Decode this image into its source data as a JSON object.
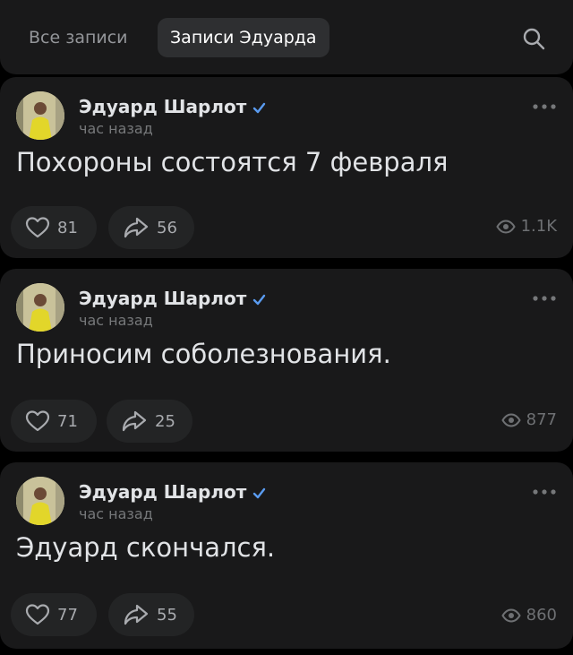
{
  "tabs": [
    {
      "label": "Все записи",
      "active": false
    },
    {
      "label": "Записи Эдуарда",
      "active": true
    }
  ],
  "colors": {
    "background": "#000000",
    "card": "#19191a",
    "accent": "#5a9bf0",
    "muted": "#76787a"
  },
  "posts": [
    {
      "author": "Эдуард Шарлот",
      "time": "час назад",
      "text": "Похороны состоятся 7 февраля",
      "likes": "81",
      "shares": "56",
      "views": "1.1K"
    },
    {
      "author": "Эдуард Шарлот",
      "time": "час назад",
      "text": "Приносим соболезнования.",
      "likes": "71",
      "shares": "25",
      "views": "877"
    },
    {
      "author": "Эдуард Шарлот",
      "time": "час назад",
      "text": "Эдуард скончался.",
      "likes": "77",
      "shares": "55",
      "views": "860"
    }
  ]
}
